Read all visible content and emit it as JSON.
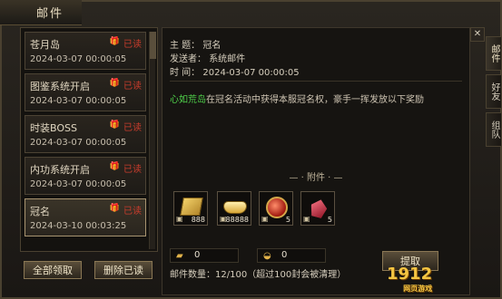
{
  "window": {
    "title": "邮件"
  },
  "mail_list": [
    {
      "name": "苍月岛",
      "date": "2024-03-07 00:00:05",
      "status": "已读"
    },
    {
      "name": "图鉴系统开启",
      "date": "2024-03-07 00:00:05",
      "status": "已读"
    },
    {
      "name": "时装BOSS",
      "date": "2024-03-07 00:00:05",
      "status": "已读"
    },
    {
      "name": "内功系统开启",
      "date": "2024-03-07 00:00:05",
      "status": "已读"
    },
    {
      "name": "冠名",
      "date": "2024-03-10 00:03:25",
      "status": "已读"
    }
  ],
  "buttons": {
    "claim_all": "全部领取",
    "delete_read": "删除已读",
    "extract": "提取"
  },
  "detail": {
    "subject_label": "主  题：",
    "subject": "冠名",
    "sender_label": "发送者：",
    "sender": "系统邮件",
    "time_label": "时  间：",
    "time": "2024-03-07 00:00:05",
    "body_highlight": "心如荒岛",
    "body": "在冠名活动中获得本服冠名权，豪手一挥发放以下奖励",
    "attachment_label": "附件",
    "attachments": [
      {
        "name": "金条",
        "qty": "888",
        "icon": "gold-bar-icon"
      },
      {
        "name": "元宝",
        "qty": "88888",
        "icon": "ingot-icon"
      },
      {
        "name": "红宝珠",
        "qty": "5",
        "icon": "red-orb-icon"
      },
      {
        "name": "宝石",
        "qty": "5",
        "icon": "gem-icon"
      }
    ],
    "currency_1": "0",
    "currency_2": "0",
    "mail_count": "邮件数量：12/100（超过100封会被清理）"
  },
  "side_tabs": [
    "邮件",
    "好友",
    "组队"
  ],
  "watermark": {
    "text": "1912",
    "sub": "网页游戏"
  }
}
